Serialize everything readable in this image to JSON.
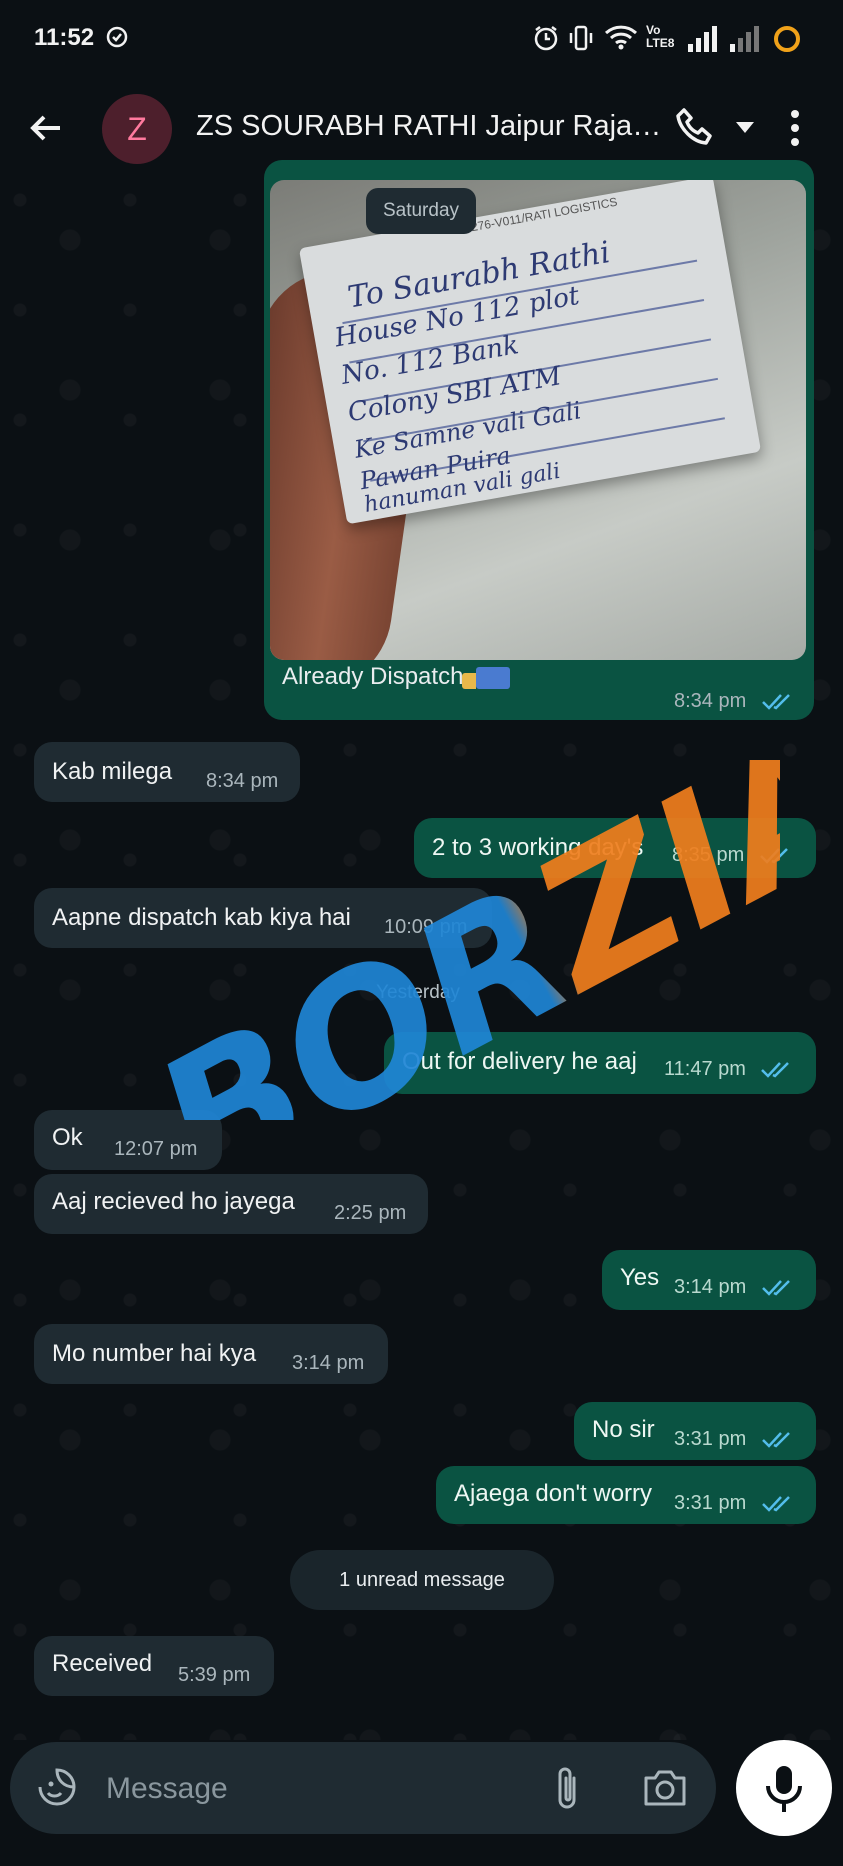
{
  "status_bar": {
    "time": "11:52",
    "network": "Vo LTE8"
  },
  "header": {
    "avatar_letter": "Z",
    "title": "ZS SOURABH RATHI Jaipur Rajas..."
  },
  "image_message": {
    "date_chip": "Saturday",
    "photo_handwriting": [
      "To Saurabh Rathi",
      "House No 112 plot",
      "No. 112 Bank",
      "Colony SBI ATM",
      "Ke Samne vali Gali",
      "Pawan Puira",
      "hanuman vali gali"
    ],
    "photo_label": "30276-V011/RATI LOGISTICS",
    "caption": "Already Dispatch",
    "time": "8:34 pm"
  },
  "messages": [
    {
      "dir": "in",
      "text": "Kab milega",
      "time": "8:34 pm"
    },
    {
      "dir": "out",
      "text": "2 to 3 working day's",
      "time": "8:35 pm"
    },
    {
      "dir": "in",
      "text": "Aapne dispatch kab kiya hai",
      "time": "10:09 pm"
    },
    {
      "dir": "out",
      "text": "Out for delivery he aaj",
      "time": "11:47 pm"
    },
    {
      "dir": "in",
      "text": "Ok",
      "time": "12:07 pm"
    },
    {
      "dir": "in",
      "text": "Aaj recieved ho jayega",
      "time": "2:25 pm"
    },
    {
      "dir": "out",
      "text": "Yes",
      "time": "3:14 pm"
    },
    {
      "dir": "in",
      "text": "Mo number hai kya",
      "time": "3:14 pm"
    },
    {
      "dir": "out",
      "text": "No sir",
      "time": "3:31 pm"
    },
    {
      "dir": "out",
      "text": "Ajaega don't worry",
      "time": "3:31 pm"
    },
    {
      "dir": "in",
      "text": "Received",
      "time": "5:39 pm"
    }
  ],
  "date_separators": {
    "yesterday": "Yesterday"
  },
  "unread_banner": "1 unread message",
  "watermark": "BORZIA",
  "compose": {
    "placeholder": "Message"
  },
  "colors": {
    "incoming_bubble": "#1f2b32",
    "outgoing_bubble": "#0a5342",
    "read_ticks": "#53bdeb",
    "background": "#0b1014"
  }
}
